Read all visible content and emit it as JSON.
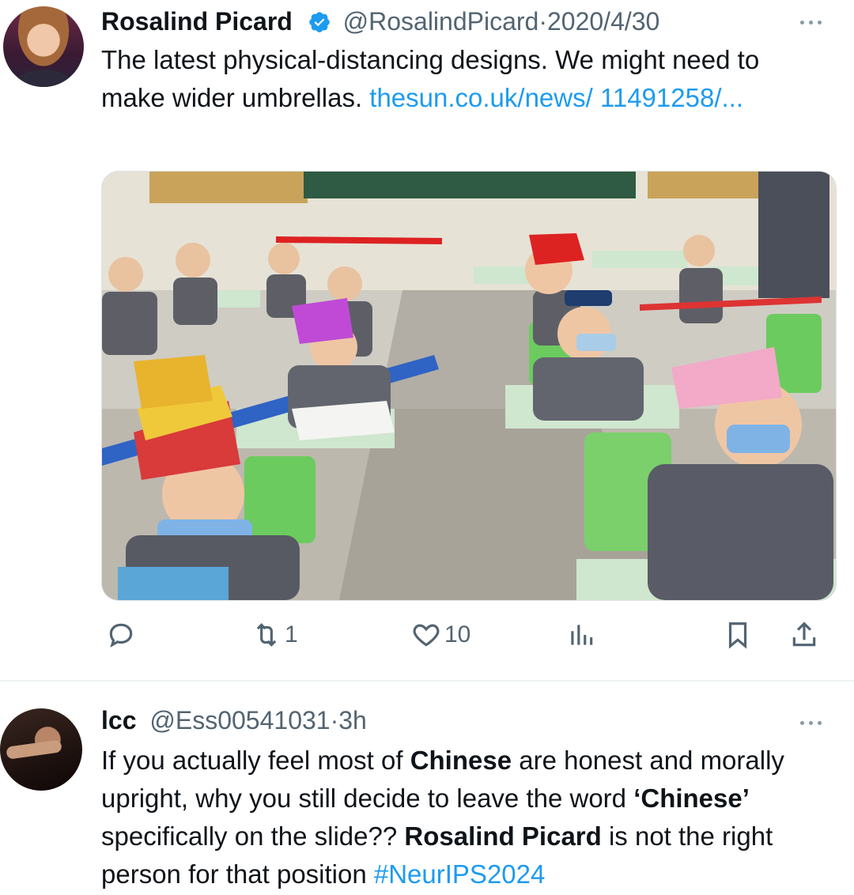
{
  "tweet": {
    "author_name": "Rosalind Picard",
    "handle": "@RosalindPicard",
    "separator": "·",
    "date": "2020/4/30",
    "text_1": "The latest physical-distancing designs.  We might need to make wider umbrellas. ",
    "link": "thesun.co.uk/news/ 11491258/...",
    "actions": {
      "reply_count": "",
      "retweet_count": "1",
      "like_count": "10"
    }
  },
  "reply": {
    "author_name": "lcc",
    "handle": "@Ess00541031",
    "separator": "·",
    "time": "3h",
    "text_parts": {
      "p1": "If you actually feel most of ",
      "p2": "Chinese",
      "p3": " are honest and morally upright, why you still decide to leave the word ",
      "p4": "‘Chinese’",
      "p5": " specifically on the slide?? ",
      "p6": "Rosalind Picard",
      "p7": " is not the right person for that position ",
      "hashtag": "#NeurIPS2024"
    }
  },
  "icons": {
    "verified": "verified-badge-icon",
    "more": "more-dots-icon",
    "reply": "reply-icon",
    "retweet": "retweet-icon",
    "like": "heart-icon",
    "views": "views-bar-icon",
    "bookmark": "bookmark-icon",
    "share": "share-icon"
  },
  "colors": {
    "link": "#1d9bf0",
    "secondary_text": "#536471",
    "verified": "#1d9bf0"
  }
}
